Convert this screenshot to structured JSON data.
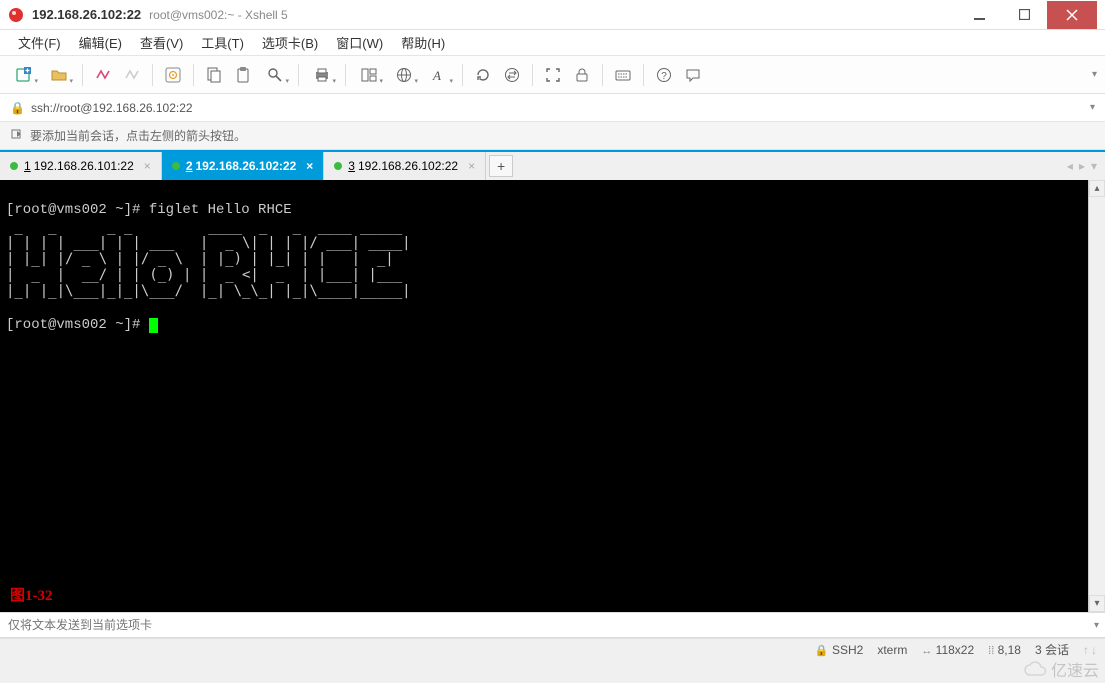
{
  "title": {
    "main": "192.168.26.102:22",
    "sub": "root@vms002:~ - Xshell 5"
  },
  "menus": [
    "文件(F)",
    "编辑(E)",
    "查看(V)",
    "工具(T)",
    "选项卡(B)",
    "窗口(W)",
    "帮助(H)"
  ],
  "address": "ssh://root@192.168.26.102:22",
  "info_hint": "要添加当前会话，点击左侧的箭头按钮。",
  "tabs": [
    {
      "num": "1",
      "label": "192.168.26.101:22",
      "active": false
    },
    {
      "num": "2",
      "label": "192.168.26.102:22",
      "active": true
    },
    {
      "num": "3",
      "label": "192.168.26.102:22",
      "active": false
    }
  ],
  "terminal": {
    "command_line": "[root@vms002 ~]# figlet Hello RHCE",
    "ascii": " _   _      _ _         ____  _   _  ____ _____\n| | | | ___| | | ___   |  _ \\| | | |/ ___| ____|\n| |_| |/ _ \\ | |/ _ \\  | |_) | |_| | |   |  _|\n|  _  |  __/ | | (_) | |  _ <|  _  | |___| |___\n|_| |_|\\___|_|_|\\___/  |_| \\_\\_| |_|\\____|_____|",
    "prompt2": "[root@vms002 ~]# ",
    "fig_label": "图1-32"
  },
  "bottom_placeholder": "仅将文本发送到当前选项卡",
  "status": {
    "proto": "SSH2",
    "term": "xterm",
    "size": "118x22",
    "cursor": "8,18",
    "sessions": "3 会话"
  },
  "watermark": "亿速云"
}
